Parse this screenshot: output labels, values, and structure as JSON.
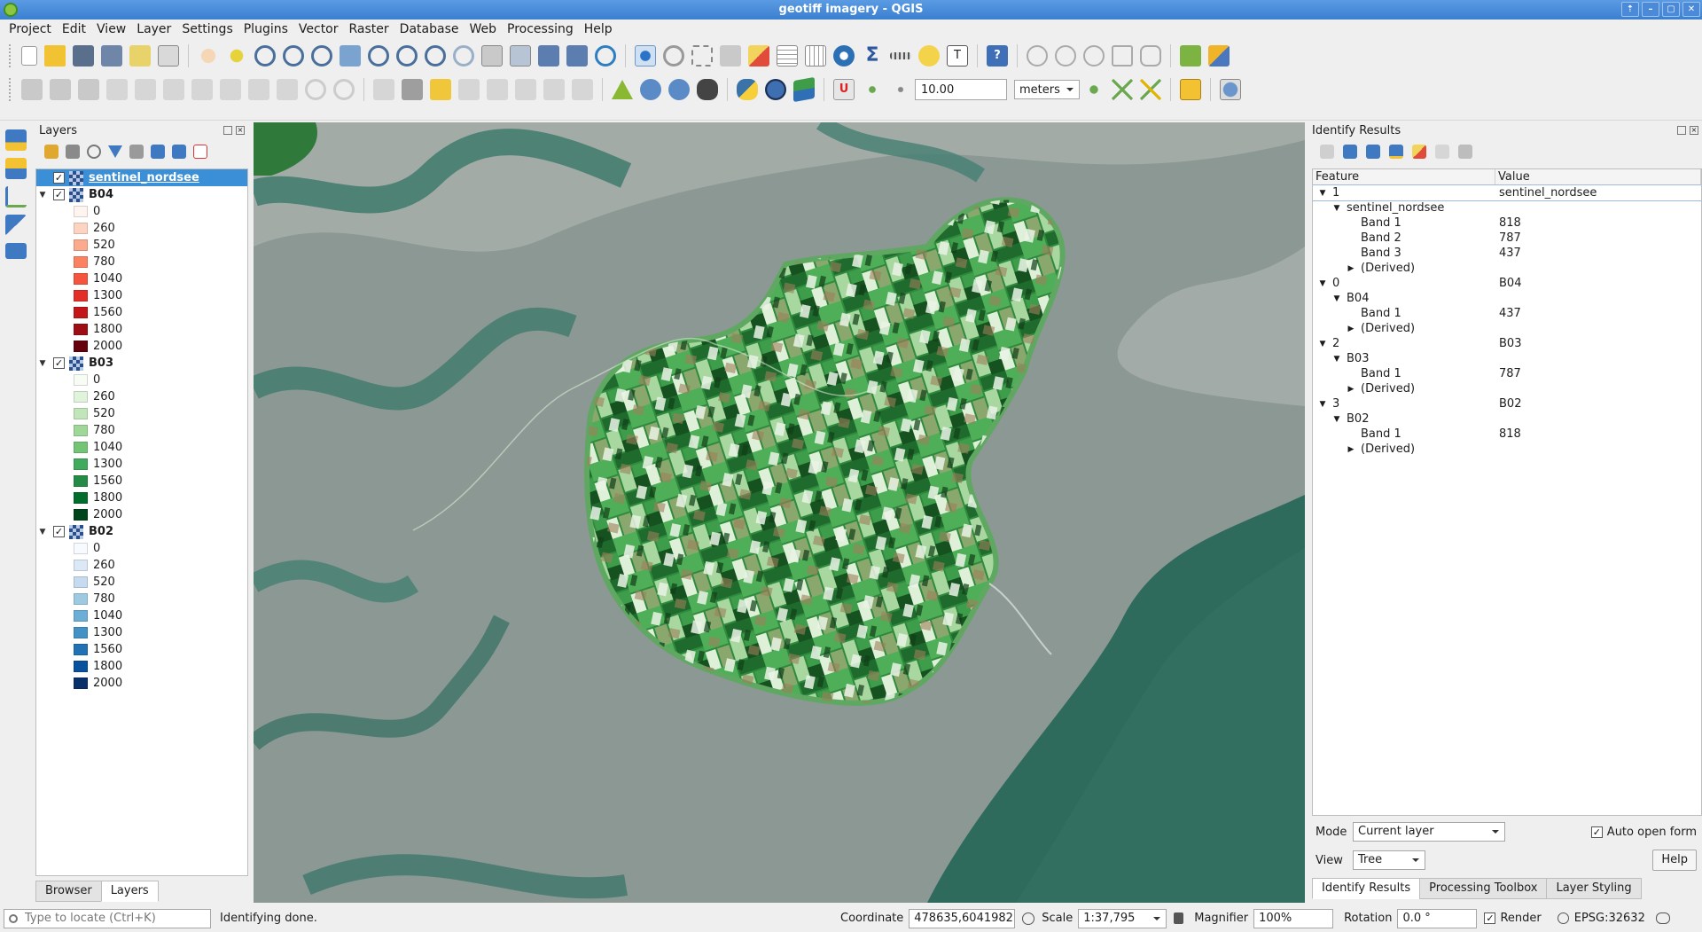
{
  "window": {
    "title": "geotiff imagery - QGIS",
    "buttons": [
      "⇡",
      "–",
      "▢",
      "✕"
    ]
  },
  "menu": [
    "Project",
    "Edit",
    "View",
    "Layer",
    "Settings",
    "Plugins",
    "Vector",
    "Raster",
    "Database",
    "Web",
    "Processing",
    "Help"
  ],
  "toolbar": {
    "snap_tolerance": "10.00",
    "snap_units": "meters"
  },
  "layers_panel": {
    "title": "Layers",
    "items": [
      {
        "name": "sentinel_nordsee",
        "selected": true,
        "checked": true
      },
      {
        "name": "B04",
        "checked": true,
        "classes": [
          {
            "label": "0",
            "color": "#fff5f0"
          },
          {
            "label": "260",
            "color": "#fdd4c2"
          },
          {
            "label": "520",
            "color": "#fcaa8e"
          },
          {
            "label": "780",
            "color": "#fc8161"
          },
          {
            "label": "1040",
            "color": "#f5553c"
          },
          {
            "label": "1300",
            "color": "#e32f27"
          },
          {
            "label": "1560",
            "color": "#c2161b"
          },
          {
            "label": "1800",
            "color": "#9e0d14"
          },
          {
            "label": "2000",
            "color": "#67000d"
          }
        ]
      },
      {
        "name": "B03",
        "checked": true,
        "classes": [
          {
            "label": "0",
            "color": "#f7fcf5"
          },
          {
            "label": "260",
            "color": "#e0f3db"
          },
          {
            "label": "520",
            "color": "#c1e6ba"
          },
          {
            "label": "780",
            "color": "#9ed798"
          },
          {
            "label": "1040",
            "color": "#74c476"
          },
          {
            "label": "1300",
            "color": "#41ab5d"
          },
          {
            "label": "1560",
            "color": "#238b45"
          },
          {
            "label": "1800",
            "color": "#006d2c"
          },
          {
            "label": "2000",
            "color": "#00441b"
          }
        ]
      },
      {
        "name": "B02",
        "checked": true,
        "classes": [
          {
            "label": "0",
            "color": "#f7fbff"
          },
          {
            "label": "260",
            "color": "#dbe9f6"
          },
          {
            "label": "520",
            "color": "#c6dbef"
          },
          {
            "label": "780",
            "color": "#9ecae1"
          },
          {
            "label": "1040",
            "color": "#6baed6"
          },
          {
            "label": "1300",
            "color": "#4292c6"
          },
          {
            "label": "1560",
            "color": "#2171b5"
          },
          {
            "label": "1800",
            "color": "#08519c"
          },
          {
            "label": "2000",
            "color": "#08306b"
          }
        ]
      }
    ],
    "tabs": [
      "Browser",
      "Layers"
    ]
  },
  "identify": {
    "title": "Identify Results",
    "headers": [
      "Feature",
      "Value"
    ],
    "rows": [
      {
        "indent": 0,
        "arrow": "▼",
        "feature": "1",
        "value": "sentinel_nordsee"
      },
      {
        "indent": 1,
        "arrow": "▼",
        "feature": "sentinel_nordsee",
        "value": ""
      },
      {
        "indent": 2,
        "arrow": "",
        "feature": "Band 1",
        "value": "818"
      },
      {
        "indent": 2,
        "arrow": "",
        "feature": "Band 2",
        "value": "787"
      },
      {
        "indent": 2,
        "arrow": "",
        "feature": "Band 3",
        "value": "437"
      },
      {
        "indent": 2,
        "arrow": "▶",
        "feature": "(Derived)",
        "value": ""
      },
      {
        "indent": 0,
        "arrow": "▼",
        "feature": "0",
        "value": "B04"
      },
      {
        "indent": 1,
        "arrow": "▼",
        "feature": "B04",
        "value": ""
      },
      {
        "indent": 2,
        "arrow": "",
        "feature": "Band 1",
        "value": "437"
      },
      {
        "indent": 2,
        "arrow": "▶",
        "feature": "(Derived)",
        "value": ""
      },
      {
        "indent": 0,
        "arrow": "▼",
        "feature": "2",
        "value": "B03"
      },
      {
        "indent": 1,
        "arrow": "▼",
        "feature": "B03",
        "value": ""
      },
      {
        "indent": 2,
        "arrow": "",
        "feature": "Band 1",
        "value": "787"
      },
      {
        "indent": 2,
        "arrow": "▶",
        "feature": "(Derived)",
        "value": ""
      },
      {
        "indent": 0,
        "arrow": "▼",
        "feature": "3",
        "value": "B02"
      },
      {
        "indent": 1,
        "arrow": "▼",
        "feature": "B02",
        "value": ""
      },
      {
        "indent": 2,
        "arrow": "",
        "feature": "Band 1",
        "value": "818"
      },
      {
        "indent": 2,
        "arrow": "▶",
        "feature": "(Derived)",
        "value": ""
      }
    ],
    "mode_label": "Mode",
    "mode_value": "Current layer",
    "auto_open": "Auto open form",
    "view_label": "View",
    "view_value": "Tree",
    "help": "Help",
    "tabs": [
      "Identify Results",
      "Processing Toolbox",
      "Layer Styling"
    ]
  },
  "status": {
    "locate_placeholder": "Type to locate (Ctrl+K)",
    "message": "Identifying done.",
    "coordinate_label": "Coordinate",
    "coordinate": "478635,6041982",
    "scale_label": "Scale",
    "scale": "1:37,795",
    "magnifier_label": "Magnifier",
    "magnifier": "100%",
    "rotation_label": "Rotation",
    "rotation": "0.0 °",
    "render_label": "Render",
    "crs": "EPSG:32632"
  }
}
